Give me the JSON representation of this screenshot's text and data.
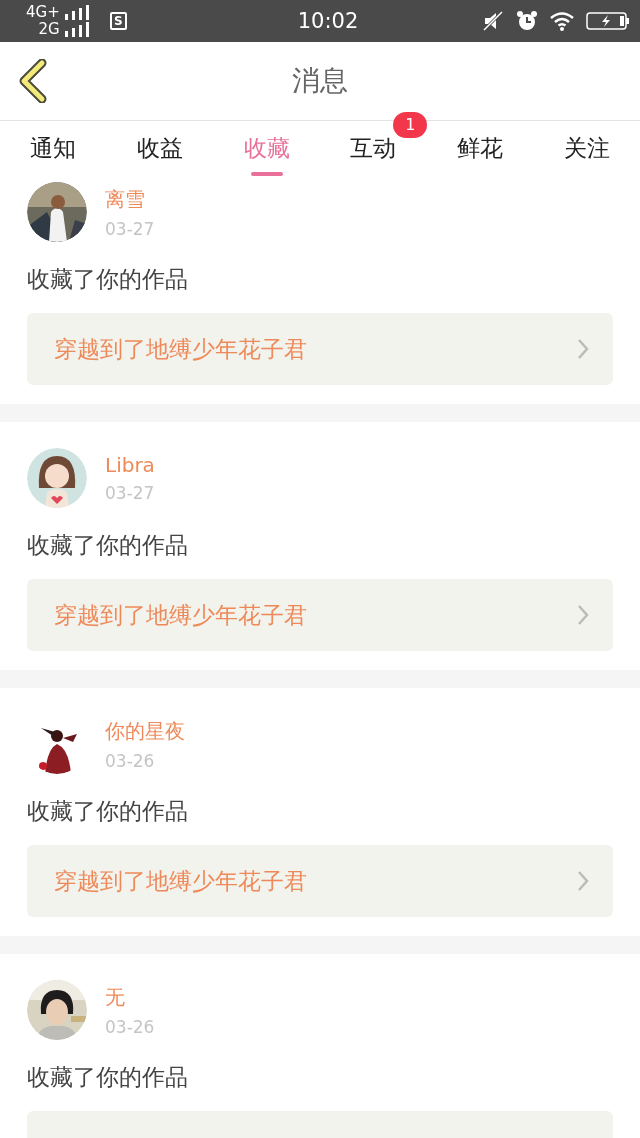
{
  "status_bar": {
    "networks": [
      {
        "label": "4G+"
      },
      {
        "label": "2G"
      }
    ],
    "app_badge": "S",
    "time": "10:02"
  },
  "header": {
    "title": "消息"
  },
  "tabs": [
    {
      "label": "通知",
      "selected": false
    },
    {
      "label": "收益",
      "selected": false
    },
    {
      "label": "收藏",
      "selected": true
    },
    {
      "label": "互动",
      "selected": false,
      "badge": "1"
    },
    {
      "label": "鲜花",
      "selected": false
    },
    {
      "label": "关注",
      "selected": false
    }
  ],
  "messages": [
    {
      "name": "离雪",
      "date": "03-27",
      "action": "收藏了你的作品",
      "work": "穿越到了地缚少年花子君"
    },
    {
      "name": "Libra",
      "date": "03-27",
      "action": "收藏了你的作品",
      "work": "穿越到了地缚少年花子君"
    },
    {
      "name": "你的星夜",
      "date": "03-26",
      "action": "收藏了你的作品",
      "work": "穿越到了地缚少年花子君"
    },
    {
      "name": "无",
      "date": "03-26",
      "action": "收藏了你的作品"
    }
  ]
}
